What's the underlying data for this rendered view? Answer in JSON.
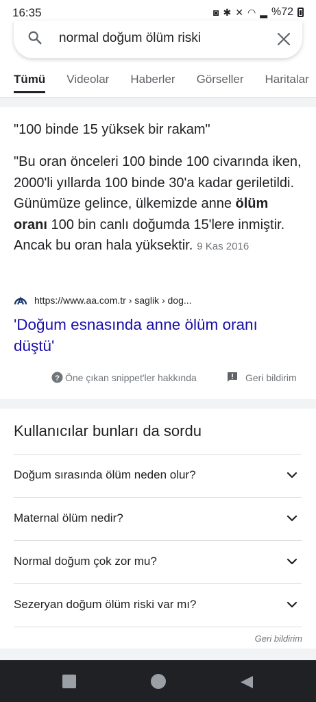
{
  "status_bar": {
    "time": "16:35",
    "battery": "%72"
  },
  "search": {
    "query": "normal doğum ölüm riski"
  },
  "tabs": [
    {
      "label": "Tümü",
      "active": true
    },
    {
      "label": "Videolar",
      "active": false
    },
    {
      "label": "Haberler",
      "active": false
    },
    {
      "label": "Görseller",
      "active": false
    },
    {
      "label": "Haritalar",
      "active": false
    }
  ],
  "featured_snippet": {
    "title": "\"100 binde 15 yüksek bir rakam\"",
    "body_before": "\"Bu oran önceleri 100 binde 100 civarında iken, 2000'li yıllarda 100 binde 30'a kadar geriletildi. Günümüze gelince, ülkemizde anne ",
    "body_bold": "ölüm oranı",
    "body_after": " 100 bin canlı doğumda 15'lere inmiştir. Ancak bu oran hala yüksektir.",
    "date": "9 Kas 2016",
    "source_url": "https://www.aa.com.tr › saglik › dog...",
    "link_title": "'Doğum esnasında anne ölüm oranı düştü'",
    "about_label": "Öne çıkan snippet'ler hakkında",
    "feedback_label": "Geri bildirim"
  },
  "people_also_ask": {
    "heading": "Kullanıcılar bunları da sordu",
    "questions": [
      "Doğum sırasında ölüm neden olur?",
      "Maternal ölüm nedir?",
      "Normal doğum çok zor mu?",
      "Sezeryan doğum ölüm riski var mı?"
    ],
    "feedback_label": "Geri bildirim"
  },
  "colors": {
    "link": "#1a0dab",
    "text": "#202124",
    "secondary_text": "#70757a",
    "nav_bar": "#202124",
    "divider": "#dadce0",
    "band": "#f1f3f4"
  },
  "icons": [
    "search-icon",
    "clear-icon",
    "help-icon",
    "feedback-icon",
    "chevron-down-icon",
    "aa-logo-icon",
    "recents-icon",
    "home-icon",
    "back-icon"
  ]
}
